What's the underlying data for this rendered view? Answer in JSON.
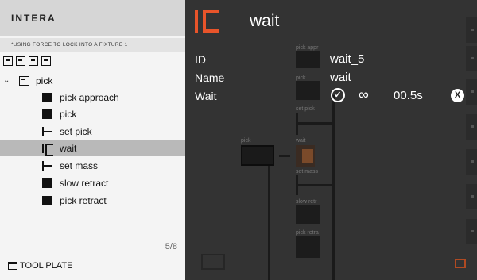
{
  "left": {
    "app_title": "INTERA",
    "subtitle": "*USING FORCE TO LOCK INTO A FIXTURE 1",
    "toolbar_icons": [
      "layout-icon",
      "layout-icon",
      "refresh-icon",
      "layout-icon"
    ],
    "tree_root": {
      "label": "pick"
    },
    "items": [
      {
        "label": "pick approach",
        "icon": "block-icon"
      },
      {
        "label": "pick",
        "icon": "block-icon"
      },
      {
        "label": "set pick",
        "icon": "set-icon"
      },
      {
        "label": "wait",
        "icon": "wait-icon",
        "selected": true
      },
      {
        "label": "set mass",
        "icon": "set-icon"
      },
      {
        "label": "slow retract",
        "icon": "block-icon"
      },
      {
        "label": "pick retract",
        "icon": "block-icon"
      }
    ],
    "pager": "5/8",
    "footer": {
      "label": "TOOL PLATE"
    }
  },
  "detail": {
    "title": "wait",
    "id_label": "ID",
    "id_value": "wait_5",
    "name_label": "Name",
    "name_value": "wait",
    "wait_label": "Wait",
    "wait_infinity": "∞",
    "wait_time": "00.5s",
    "close_glyph": "X",
    "check_glyph": "✓",
    "accent_color": "#e8542a"
  },
  "graph": {
    "labels": [
      "pick appr",
      "pick",
      "set pick",
      "pick",
      "wait",
      "set mass",
      "slow retr",
      "pick retra"
    ]
  }
}
